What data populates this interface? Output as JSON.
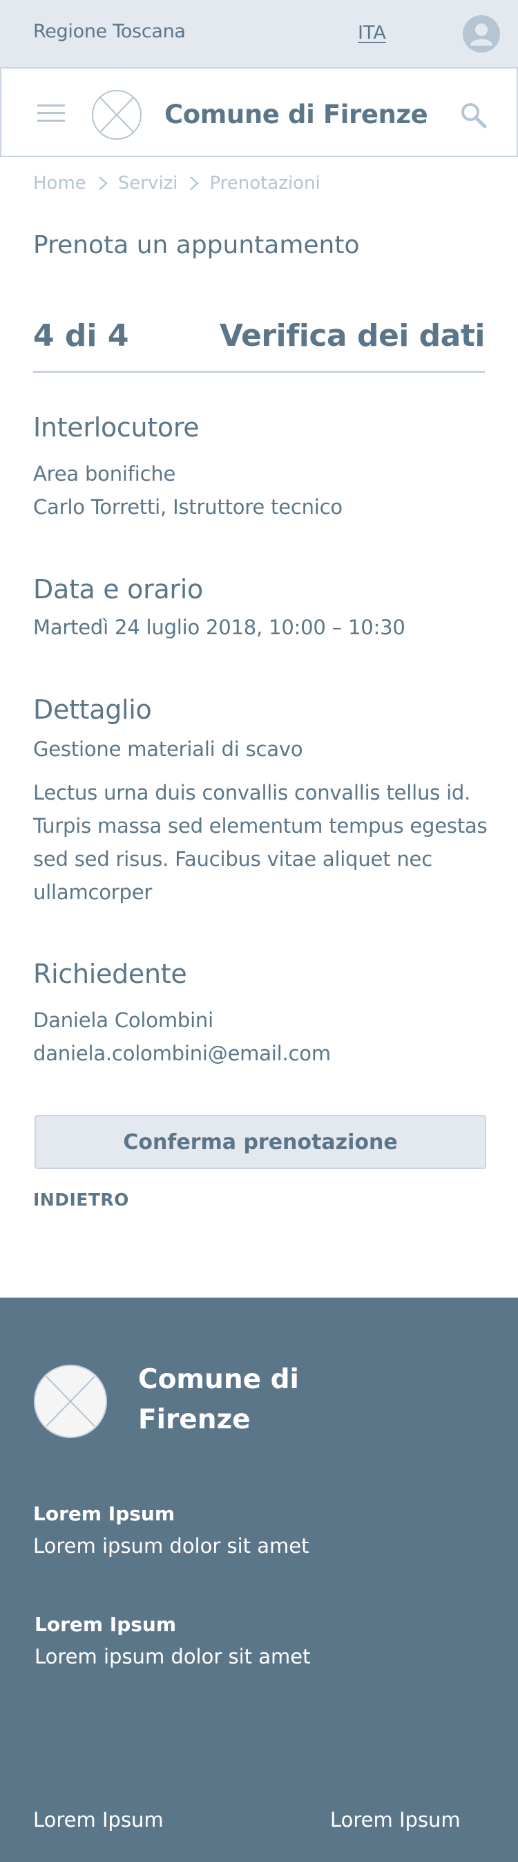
{
  "topbar": {
    "region": "Regione Toscana",
    "language": "ITA",
    "user_icon": "user-avatar-icon"
  },
  "header": {
    "menu_icon": "hamburger-menu-icon",
    "logo_icon": "placeholder-logo-icon",
    "title": "Comune di Firenze",
    "search_icon": "search-icon"
  },
  "breadcrumb": {
    "items": [
      "Home",
      "Servizi",
      "Prenotazioni"
    ],
    "separator_icon": "chevron-right-icon"
  },
  "page_title": "Prenota un appuntamento",
  "step": {
    "number": "4 di 4",
    "title": "Verifica dei dati"
  },
  "sections": {
    "interlocutore": {
      "heading": "Interlocutore",
      "line1": "Area bonifiche",
      "line2": "Carlo Torretti, Istruttore tecnico"
    },
    "data_orario": {
      "heading": "Data e orario",
      "value": "Martedì 24 luglio 2018, 10:00 – 10:30"
    },
    "dettaglio": {
      "heading": "Dettaglio",
      "subject": "Gestione materiali di scavo",
      "description": "Lectus urna duis convallis convallis tellus id. Turpis massa sed elementum tempus egestas sed sed risus. Faucibus vitae aliquet nec ullamcorper"
    },
    "richiedente": {
      "heading": "Richiedente",
      "name": "Daniela Colombini",
      "email": "daniela.colombini@email.com"
    }
  },
  "actions": {
    "confirm_label": "Conferma prenotazione",
    "back_label": "INDIETRO"
  },
  "footer": {
    "title": "Comune di Firenze",
    "blocks": [
      {
        "heading": "Lorem Ipsum",
        "text": "Lorem ipsum dolor sit amet"
      },
      {
        "heading": "Lorem Ipsum",
        "text": "Lorem ipsum dolor sit amet"
      }
    ],
    "links": [
      "Lorem Ipsum",
      "Lorem Ipsum"
    ]
  },
  "colors": {
    "primary": "#5c7689",
    "light_bg": "#e4e9ef",
    "border": "#c9d5e0",
    "muted": "#b5c5d3",
    "footer_bg": "#5c7689"
  }
}
